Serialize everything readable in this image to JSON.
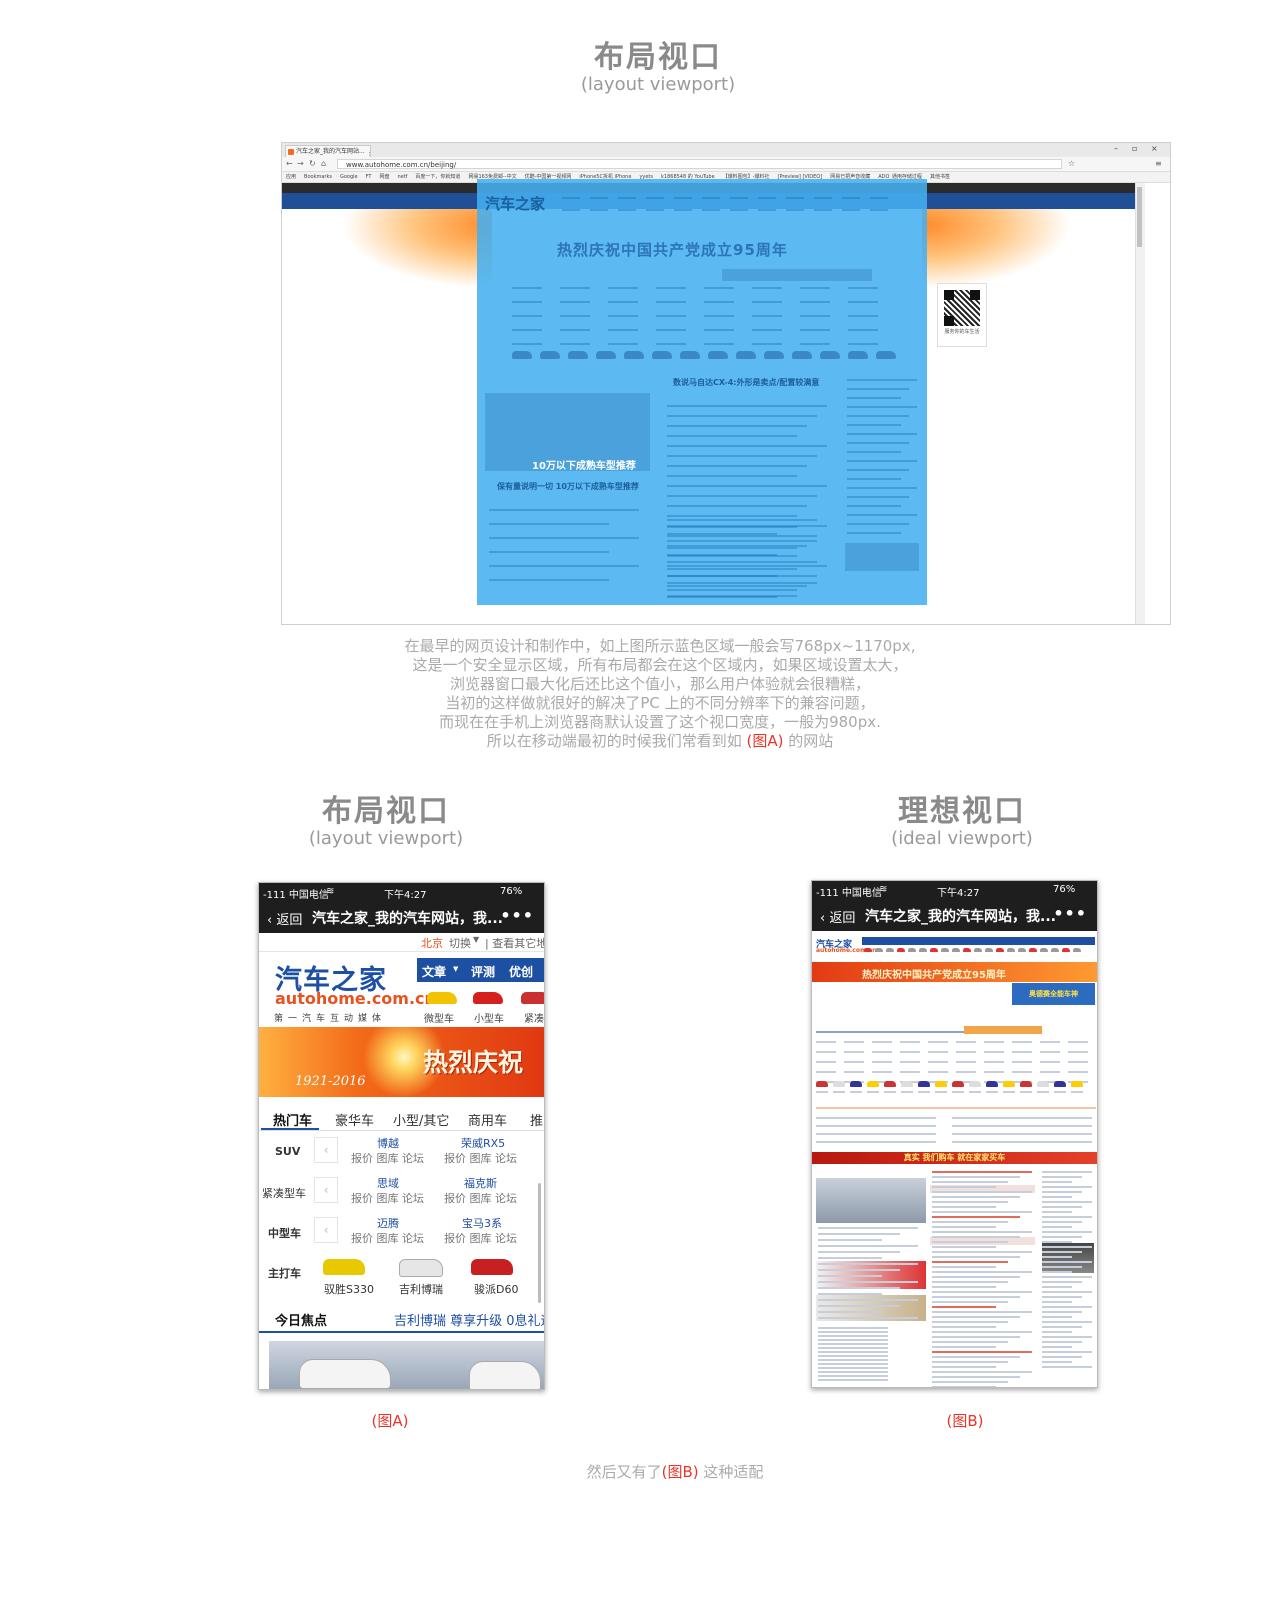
{
  "top": {
    "title": "布局视口",
    "subtitle": "(layout viewport)"
  },
  "browser": {
    "tab_title": "汽车之家_我的汽车网站...",
    "url": "www.autohome.com.cn/beijing/",
    "bookmarks": [
      "应用",
      "Bookmarks",
      "Google",
      "FT",
      "网盘",
      "netf",
      "百度一下，你就知道",
      "网易163免费邮--中文",
      "优酷-中国第一视频网",
      "iPhone5C拆机 iPhone",
      "yyets",
      "k1868548 的 YouTube",
      "【爆料图包】-爆料社",
      "[Preview] [VIDEO]",
      "网易已把声音收藏",
      "ADO_通用存储过程",
      "其他书签"
    ],
    "site_logo": "汽车之家",
    "site_banner": "热烈庆祝中国共产党成立95周年",
    "focus_headline": "数说马自达CX-4:外形是卖点/配置较满意",
    "promo": "10万以下成熟车型推荐",
    "promo_sub": "保有量说明一切 10万以下成熟车型推荐",
    "qr_caption": "服务你的车生活"
  },
  "paragraph": {
    "lines": [
      "在最早的网页设计和制作中，如上图所示蓝色区域一般会写768px~1170px,",
      "这是一个安全显示区域，所有布局都会在这个区域内，如果区域设置太大，",
      "浏览器窗口最大化后还比这个值小，那么用户体验就会很糟糕，",
      "当初的这样做就很好的解决了PC 上的不同分辨率下的兼容问题，",
      "而现在在手机上浏览器商默认设置了这个视口宽度，一般为980px.",
      "所以在移动端最初的时候我们常看到如"
    ],
    "highlight": "(图A)",
    "tail": " 的网站"
  },
  "left_section": {
    "title": "布局视口",
    "subtitle": "(layout viewport)",
    "caption": "(图A)"
  },
  "right_section": {
    "title": "理想视口",
    "subtitle": "(ideal viewport)",
    "caption": "(图B)"
  },
  "phone": {
    "carrier": "-111 中国电信",
    "time": "下午4:27",
    "battery": "76%",
    "back": "返回",
    "page_title": "汽车之家_我的汽车网站，我...",
    "more": "•••"
  },
  "phone_a": {
    "city": "北京",
    "switch": "切换",
    "other": "| 查看其它地",
    "logo": "汽车之家",
    "logo_url": "autohome.com.cn",
    "slogan": "第一汽车互动媒体",
    "nav": [
      "文章",
      "评测",
      "优创"
    ],
    "car_types": [
      "微型车",
      "小型车",
      "紧凑"
    ],
    "banner_year": "1921-2016",
    "banner_text": "热烈庆祝",
    "tabs": [
      "热门车",
      "豪华车",
      "小型/其它",
      "商用车",
      "推"
    ],
    "rows": [
      {
        "label": "SUV",
        "cars": [
          "博越",
          "荣威RX5"
        ]
      },
      {
        "label": "紧凑型车",
        "cars": [
          "思域",
          "福克斯"
        ]
      },
      {
        "label": "中型车",
        "cars": [
          "迈腾",
          "宝马3系"
        ]
      }
    ],
    "links": "报价 图库 论坛",
    "hot_label": "主打车",
    "hot_cars": [
      "驭胜S330",
      "吉利博瑞",
      "骏派D60"
    ],
    "focus_title": "今日焦点",
    "focus_links": "吉利博瑞  尊享升级  0息礼遇"
  },
  "phone_b": {
    "logo": "汽车之家",
    "logo_url": "autohome.com.cn",
    "banner": "热烈庆祝中国共产党成立95周年",
    "ad": "奥德赛全能车神",
    "red_bar": "真实 我们购车 就在家家买车"
  },
  "footer": {
    "prefix": "然后又有了",
    "highlight": "(图B)",
    "suffix": " 这种适配"
  },
  "colors": {
    "accent_red": "#e8352a",
    "viewport_blue": "#46aff0",
    "autohome_blue": "#1d4fa3"
  }
}
